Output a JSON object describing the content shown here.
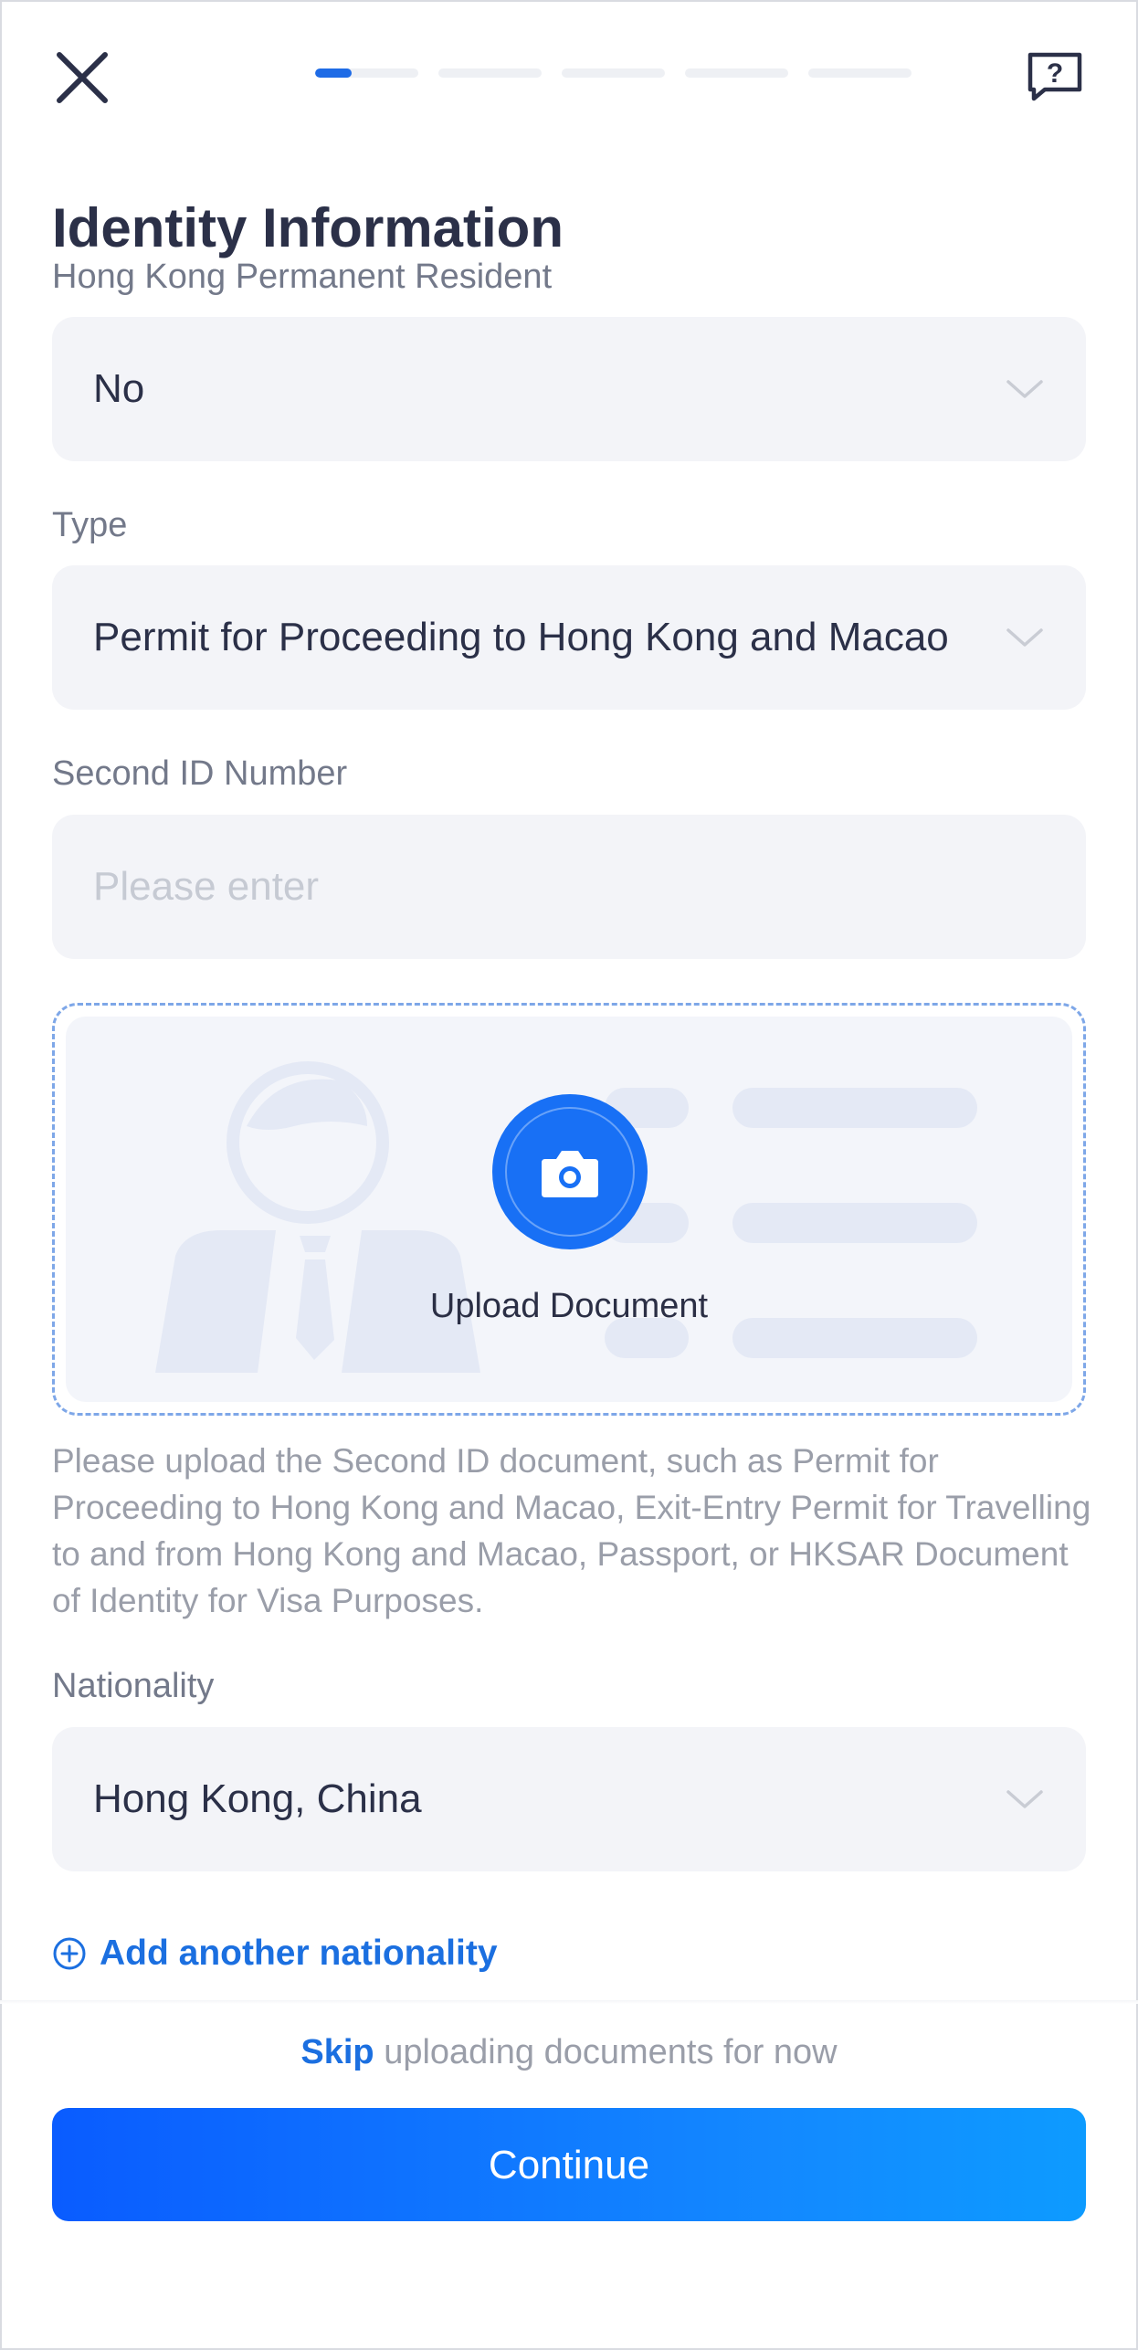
{
  "header": {
    "close_icon": "close-icon",
    "help_icon": "help-chat-icon",
    "progress": {
      "total_steps": 5,
      "current_step": 1,
      "current_step_fill": 0.35,
      "active_color": "#1e6be6",
      "inactive_color": "#eef0f4"
    }
  },
  "page": {
    "title": "Identity Information"
  },
  "form": {
    "permanent_resident": {
      "label": "Hong Kong Permanent Resident",
      "value": "No"
    },
    "type": {
      "label": "Type",
      "value": "Permit for Proceeding to Hong Kong and Macao"
    },
    "second_id": {
      "label": "Second ID Number",
      "placeholder": "Please enter",
      "value": ""
    },
    "upload": {
      "label": "Upload Document",
      "icon": "camera-icon",
      "helper": "Please upload the Second ID document, such as Permit for Proceeding to Hong Kong and Macao, Exit-Entry Permit for Travelling to and from Hong Kong and Macao, Passport, or HKSAR Document of Identity for Visa Purposes."
    },
    "nationality": {
      "label": "Nationality",
      "value": "Hong Kong, China"
    },
    "add_nationality": {
      "label": "Add another nationality",
      "icon": "plus-circle-icon"
    }
  },
  "footer": {
    "skip_link": "Skip",
    "skip_rest": "uploading documents for now",
    "continue": "Continue"
  },
  "colors": {
    "accent": "#1b6fe0",
    "button_start": "#0a5cff",
    "button_end": "#0d9bff",
    "field_bg": "#f3f4f8"
  }
}
